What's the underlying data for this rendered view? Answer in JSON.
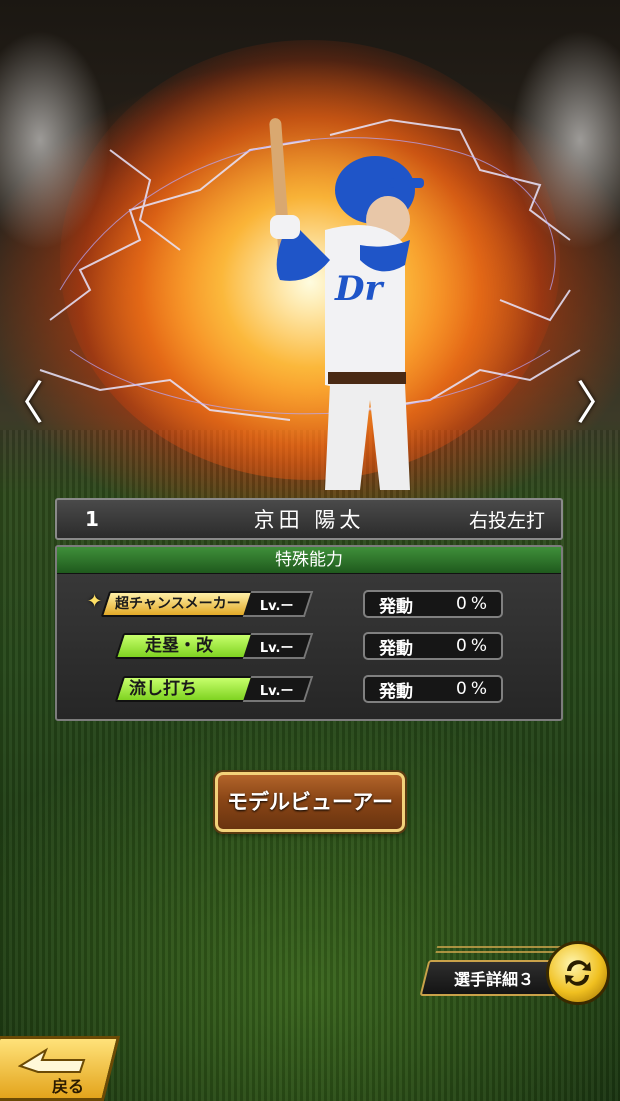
{
  "player": {
    "number": "1",
    "name": "京田 陽太",
    "handedness": "右投左打"
  },
  "abilities_panel": {
    "title": "特殊能力",
    "items": [
      {
        "name": "超チャンスメーカー",
        "prefix": "超",
        "level": "Lv.ー",
        "activation_label": "発動",
        "activation_value": "0%",
        "badge_color": "#e2a927"
      },
      {
        "name": "走塁・改",
        "level": "Lv.ー",
        "activation_label": "発動",
        "activation_value": "0%",
        "badge_color": "#7fd321"
      },
      {
        "name": "流し打ち",
        "level": "Lv.ー",
        "activation_label": "発動",
        "activation_value": "0%",
        "badge_color": "#7fd321"
      }
    ]
  },
  "buttons": {
    "model_viewer": "モデルビューアー",
    "player_detail": "選手詳細３",
    "back": "戻る"
  },
  "nav": {
    "prev_glyph": "〈",
    "next_glyph": "〉"
  },
  "icons": {
    "prev": "chevron-left-icon",
    "next": "chevron-right-icon",
    "switch": "swap-arrows-icon",
    "back": "back-arrow-icon",
    "sparkle": "sparkle-icon"
  }
}
